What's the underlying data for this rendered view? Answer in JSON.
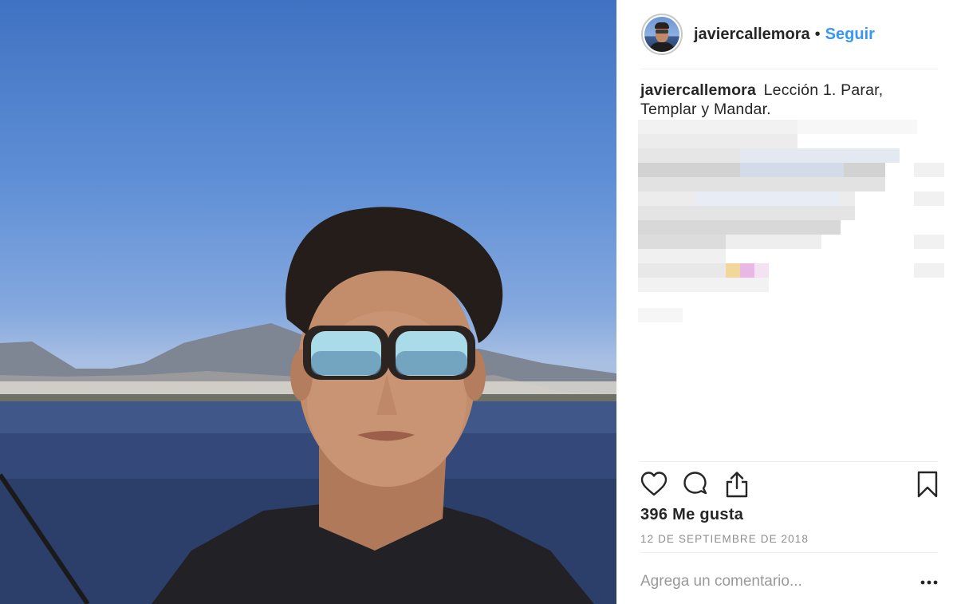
{
  "post": {
    "username": "javiercallemora",
    "separator": "•",
    "follow_label": "Seguir",
    "caption_user": "javiercallemora",
    "caption_text": "Lección 1. Parar, Templar y Mandar.",
    "likes": "396 Me gusta",
    "date": "12 DE SEPTIEMBRE DE 2018",
    "comment_placeholder": "Agrega un comentario..."
  },
  "icons": {
    "like": "heart-icon",
    "comment": "speech-bubble-icon",
    "share": "share-upload-icon",
    "save": "bookmark-icon",
    "more": "ellipsis-icon"
  },
  "colors": {
    "accent": "#3897f0",
    "text": "#262626",
    "muted": "#8e8e8e",
    "divider": "#efefef"
  }
}
